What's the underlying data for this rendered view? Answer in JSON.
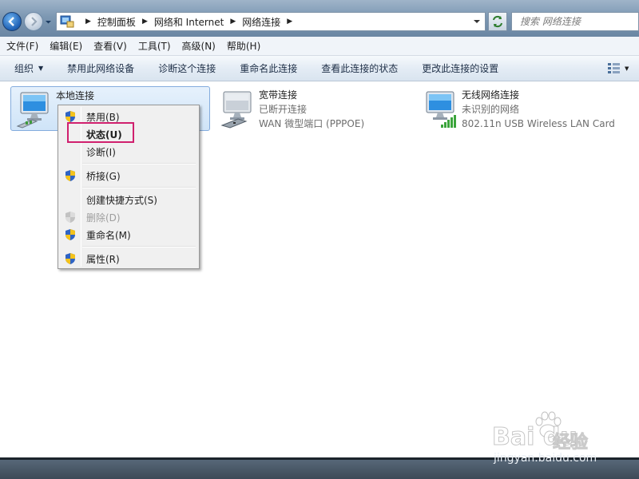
{
  "window": {
    "breadcrumb": [
      "控制面板",
      "网络和 Internet",
      "网络连接"
    ],
    "search_placeholder": "搜索 网络连接"
  },
  "menubar": [
    "文件(F)",
    "编辑(E)",
    "查看(V)",
    "工具(T)",
    "高级(N)",
    "帮助(H)"
  ],
  "commandbar": {
    "organize": "组织",
    "commands": [
      "禁用此网络设备",
      "诊断这个连接",
      "重命名此连接",
      "查看此连接的状态",
      "更改此连接的设置"
    ]
  },
  "connections": [
    {
      "name": "本地连接",
      "status": "",
      "device": "",
      "icon": "wired-lan-icon",
      "selected": true
    },
    {
      "name": "宽带连接",
      "status": "已断开连接",
      "device": "WAN 微型端口 (PPPOE)",
      "icon": "broadband-icon",
      "selected": false
    },
    {
      "name": "无线网络连接",
      "status": "未识别的网络",
      "device": "802.11n USB Wireless LAN Card",
      "icon": "wireless-icon",
      "selected": false
    }
  ],
  "context_menu": {
    "items": [
      {
        "label": "禁用(B)",
        "shield": true,
        "disabled": false,
        "bold": false
      },
      {
        "label": "状态(U)",
        "shield": false,
        "disabled": false,
        "bold": true
      },
      {
        "label": "诊断(I)",
        "shield": false,
        "disabled": false,
        "bold": false
      },
      {
        "label": "桥接(G)",
        "shield": true,
        "disabled": false,
        "bold": false
      },
      {
        "label": "创建快捷方式(S)",
        "shield": false,
        "disabled": false,
        "bold": false
      },
      {
        "label": "删除(D)",
        "shield": true,
        "disabled": true,
        "bold": false
      },
      {
        "label": "重命名(M)",
        "shield": true,
        "disabled": false,
        "bold": false
      },
      {
        "label": "属性(R)",
        "shield": true,
        "disabled": false,
        "bold": false
      }
    ],
    "highlighted": "状态(U)"
  },
  "watermark": {
    "logo": "Bai du",
    "sub": "经验",
    "url": "jingyan.baidu.com"
  },
  "colors": {
    "highlight_border": "#d0206e",
    "selection_bg": "#cfe4f8",
    "shield_blue": "#2f64c4",
    "shield_yellow": "#f4c21b"
  }
}
